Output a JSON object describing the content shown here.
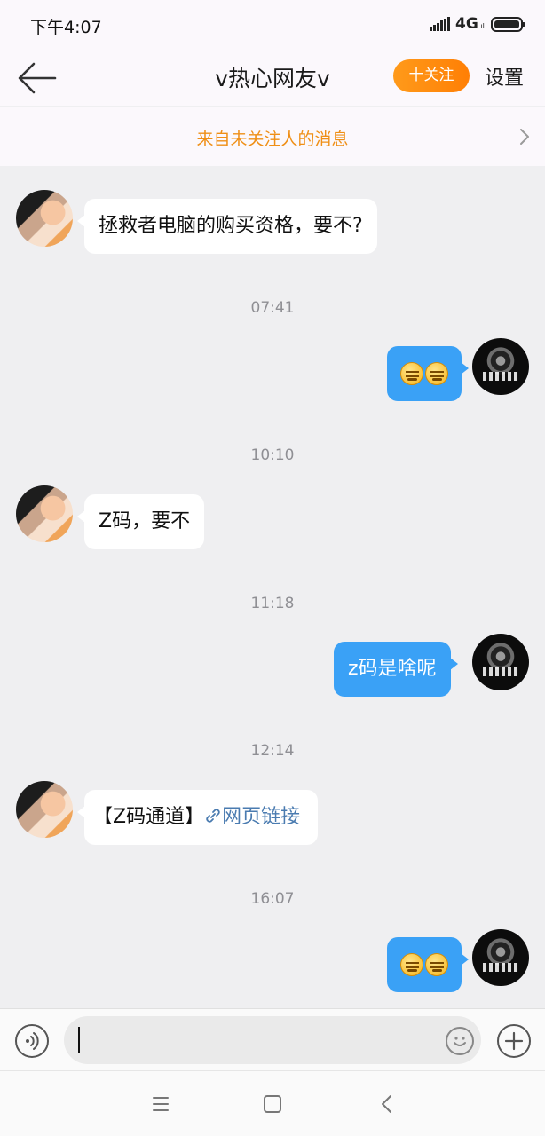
{
  "status_bar": {
    "time": "下午4:07",
    "network": "4G",
    "icons": [
      "signal-icon",
      "battery-icon"
    ]
  },
  "nav": {
    "title": "v热心网友v",
    "follow_label": "十关注",
    "settings_label": "设置",
    "icons": [
      "back-arrow-icon"
    ]
  },
  "stranger_banner": {
    "text": "来自未关注人的消息",
    "icon": "chevron-right-icon"
  },
  "messages": [
    {
      "side": "left",
      "text": "拯救者电脑的购买资格，要不?"
    },
    {
      "timestamp": "07:41"
    },
    {
      "side": "right",
      "emoji": [
        "smirk-emoji",
        "smirk-emoji"
      ]
    },
    {
      "timestamp": "10:10"
    },
    {
      "side": "left",
      "text": "Z码，要不"
    },
    {
      "timestamp": "11:18"
    },
    {
      "side": "right",
      "text": "z码是啥呢"
    },
    {
      "timestamp": "12:14"
    },
    {
      "side": "left",
      "text": "【Z码通道】",
      "link_text": "网页链接",
      "icon": "link-icon"
    },
    {
      "timestamp": "16:07"
    },
    {
      "side": "right",
      "emoji": [
        "smirk-emoji",
        "smirk-emoji"
      ]
    }
  ],
  "input_bar": {
    "placeholder": "",
    "icons": [
      "voice-icon",
      "emoji-icon",
      "plus-icon"
    ]
  },
  "system_nav": {
    "icons": [
      "menu-icon",
      "home-icon",
      "back-icon"
    ]
  },
  "colors": {
    "accent_blue": "#3aa1f6",
    "follow_orange": "#ff8f0f",
    "banner_text": "#ef8f16",
    "link_blue": "#4a7bb0",
    "chat_background": "#efeff1"
  }
}
